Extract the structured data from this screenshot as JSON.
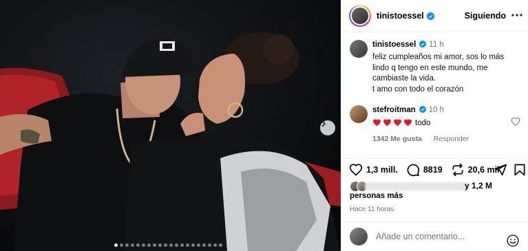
{
  "post": {
    "carousel": {
      "slide_count": 20,
      "active_index": 0,
      "next_icon": "chevron-right-icon"
    },
    "header": {
      "username": "tinistoessel",
      "verified": true,
      "follow_label": "Siguiendo",
      "more_icon": "more-horizontal-icon"
    },
    "caption": {
      "username": "tinistoessel",
      "time": "11 h",
      "lines": [
        "feliz cumpleaños mi amor, sos lo más",
        "lindo q tengo en este mundo, me",
        "cambiaste la vida.",
        "t amo con todo el corazón"
      ]
    },
    "comment": {
      "username": "stefroitman",
      "time": "10 h",
      "hearts_count": 4,
      "heart_color": "#e0182d",
      "text": "todo",
      "likes_label": "1342 Me gusta",
      "reply_label": "Responder"
    },
    "actions": {
      "likes": "1,3 mill.",
      "comments": "8819",
      "reposts": "20,6 mil"
    },
    "liked_by": {
      "suffix": "y 1,2 M",
      "more": "personas más"
    },
    "date": "Hace 11 horas",
    "add_comment": {
      "placeholder": "Añade un comentario..."
    },
    "colors": {
      "verified": "#0095f6",
      "muted": "#737373",
      "divider": "#efefef"
    }
  }
}
